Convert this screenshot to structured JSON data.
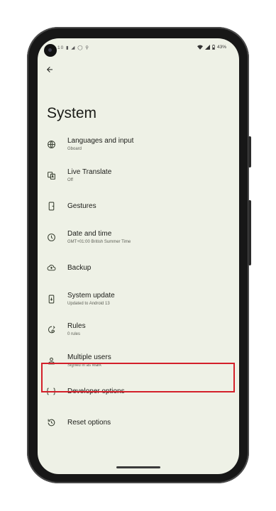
{
  "status_bar": {
    "left_icons": "10 ▮ ◢ ◯ ⚲",
    "battery": "43%"
  },
  "page": {
    "title": "System"
  },
  "settings": [
    {
      "key": "languages",
      "title": "Languages and input",
      "subtitle": "Gboard",
      "icon": "globe-icon"
    },
    {
      "key": "live-translate",
      "title": "Live Translate",
      "subtitle": "Off",
      "icon": "translate-icon"
    },
    {
      "key": "gestures",
      "title": "Gestures",
      "subtitle": "",
      "icon": "phone-gesture-icon"
    },
    {
      "key": "date-time",
      "title": "Date and time",
      "subtitle": "GMT+01:00 British Summer Time",
      "icon": "clock-icon"
    },
    {
      "key": "backup",
      "title": "Backup",
      "subtitle": "",
      "icon": "cloud-upload-icon"
    },
    {
      "key": "system-update",
      "title": "System update",
      "subtitle": "Updated to Android 13",
      "icon": "system-update-icon"
    },
    {
      "key": "rules",
      "title": "Rules",
      "subtitle": "0 rules",
      "icon": "rules-icon"
    },
    {
      "key": "multiple-users",
      "title": "Multiple users",
      "subtitle": "Signed in as Mark",
      "icon": "person-icon"
    },
    {
      "key": "developer-options",
      "title": "Developer options",
      "subtitle": "",
      "icon": "braces-icon"
    },
    {
      "key": "reset-options",
      "title": "Reset options",
      "subtitle": "",
      "icon": "reset-icon"
    }
  ],
  "highlight_color": "#d3202a",
  "screen_background": "#eef1e6"
}
